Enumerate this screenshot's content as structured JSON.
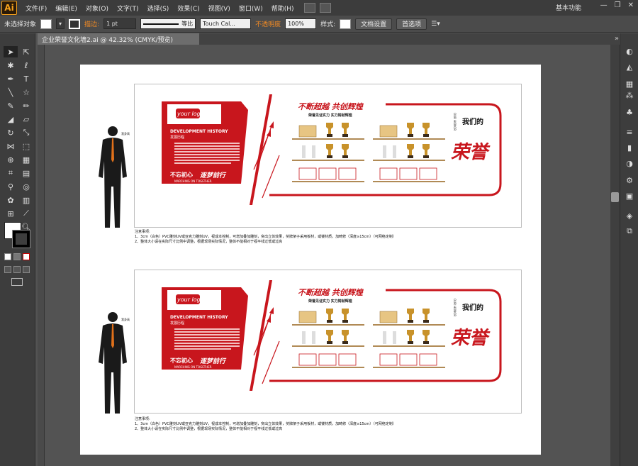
{
  "app": {
    "logo": "Ai",
    "menu": [
      "文件(F)",
      "编辑(E)",
      "对象(O)",
      "文字(T)",
      "选择(S)",
      "效果(C)",
      "视图(V)",
      "窗口(W)",
      "帮助(H)"
    ],
    "workspace": "基本功能",
    "window_controls": [
      "—",
      "❐",
      "✕"
    ]
  },
  "control_bar": {
    "selection_state": "未选择对象",
    "stroke_label": "描边:",
    "stroke_weight": "1 pt",
    "stroke_profile": "等比",
    "brush": "Touch Cal...",
    "opacity_label": "不透明度",
    "opacity_value": "100%",
    "style_label": "样式:",
    "doc_setup": "文档设置",
    "preferences": "首选项"
  },
  "document": {
    "tab_title": "企业荣誉文化墙2.ai @ 42.32% (CMYK/预览)",
    "close": "✕"
  },
  "artwork": {
    "logo_text": "your logo",
    "history_title": "DEVELOPMENT HISTORY",
    "history_subtitle": "发展历程",
    "slogan_left": "不忘初心",
    "slogan_right": "逐梦前行",
    "slogan_en": "MARCHING ON TOGETHER",
    "headline": "不断超越 共创辉煌",
    "subheadline": "荣誉见证实力 实力铸就辉煌",
    "honor_cn": "我们的",
    "honor_en": "OUR HONOR",
    "honor_big": "荣誉",
    "height_label": "我身高",
    "notes_title": "注意事项:",
    "notes_line1": "1、3cm（白色）PVC雕刻UV或亚克力雕刻UV，视成本控制，可增加叠加雕刻，突出立体效果，奖牌架子采用板材，或镂材质，加畸修（深度≥15cm）（可网络定制）",
    "notes_line2": "2、整体大小请在实际尺寸比例中调整，根据现场实际情况，整体不能相对于视平线过低或过高"
  },
  "colors": {
    "brand_red": "#c8161d",
    "gold": "#c8922a",
    "shelf": "#b08a55"
  }
}
